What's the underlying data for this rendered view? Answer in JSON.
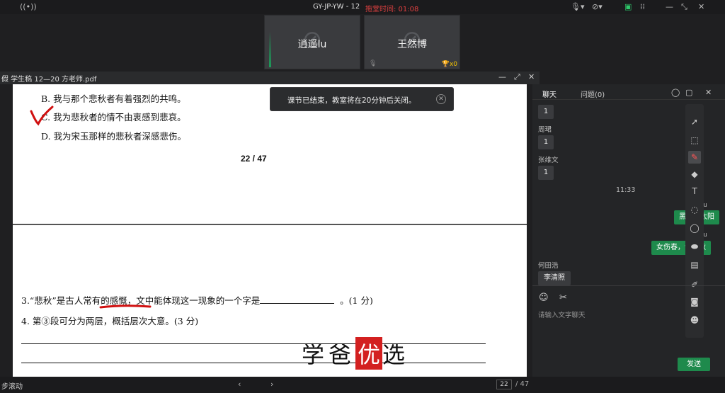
{
  "topbar": {
    "class_title": "GY-JP-YW - 12",
    "timer_text": "拖堂时间: 01:08"
  },
  "tiles": [
    {
      "name": "逍遥lu"
    },
    {
      "name": "王然博",
      "trophy": "x0"
    }
  ],
  "pdf": {
    "title": "假  学生稿 12—20 方老师.pdf",
    "option_b": "B. 我与那个悲秋者有着强烈的共鸣。",
    "option_c": "C. 我为悲秋者的情不由衷感到悲哀。",
    "option_d": "D. 我为宋玉那样的悲秋者深感悲伤。",
    "page_indicator": "22 / 47",
    "q3_pre": "3.“悲秋”是古人常有的感慨，文中能体现这一现象的一个字是",
    "q3_post": "。(1 分)",
    "q4": "4. 第③段可分为两层，概括层次大意。(3 分)",
    "watermark_a": "学爸",
    "watermark_seal": "优",
    "watermark_b": "选"
  },
  "toast": {
    "text": "课节已结束，教室将在20分钟后关闭。"
  },
  "bottombar": {
    "scroll_label": "步滚动",
    "page_current": "22",
    "page_total": "/ 47"
  },
  "chat": {
    "tab_chat": "聊天",
    "tab_questions": "问题(0)",
    "messages": [
      {
        "text": "1"
      },
      {
        "sender": "周珺",
        "text": "1"
      },
      {
        "sender": "张维文",
        "text": "1"
      },
      {
        "time": "11:33"
      },
      {
        "sender": "逍遥lu",
        "text": "黑色的太阳"
      },
      {
        "sender": "逍遥lu",
        "text": "女伤春，士悲秋"
      },
      {
        "sender": "何田浩",
        "text": "李清照"
      }
    ],
    "input_placeholder": "请输入文字聊天",
    "send_label": "发送"
  }
}
